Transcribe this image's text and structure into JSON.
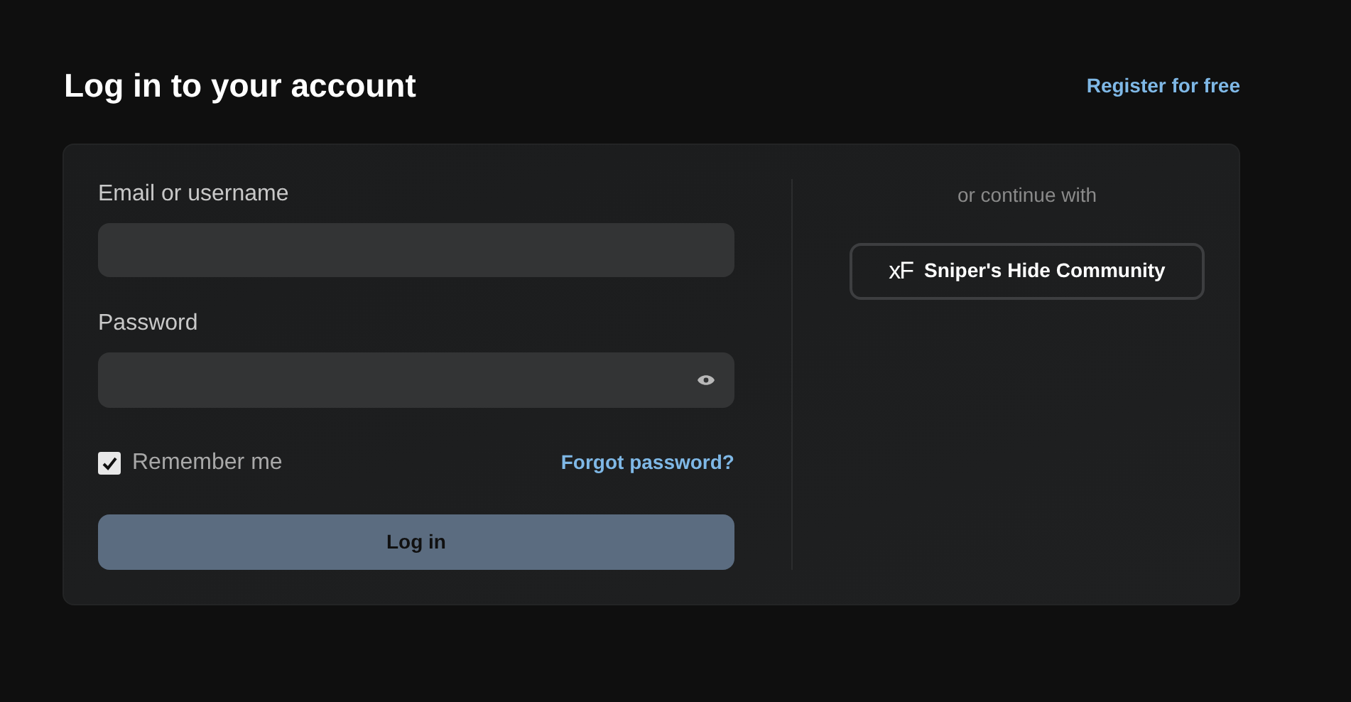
{
  "title": "Log in to your account",
  "register_link": "Register for free",
  "form": {
    "email": {
      "label": "Email or username"
    },
    "password": {
      "label": "Password"
    },
    "remember": {
      "label": "Remember me",
      "checked": true
    },
    "forgot_link": "Forgot password?",
    "submit": "Log in"
  },
  "alternatives": {
    "heading": "or continue with",
    "providers": [
      {
        "logo": "xF",
        "label": "Sniper's Hide Community"
      }
    ]
  }
}
